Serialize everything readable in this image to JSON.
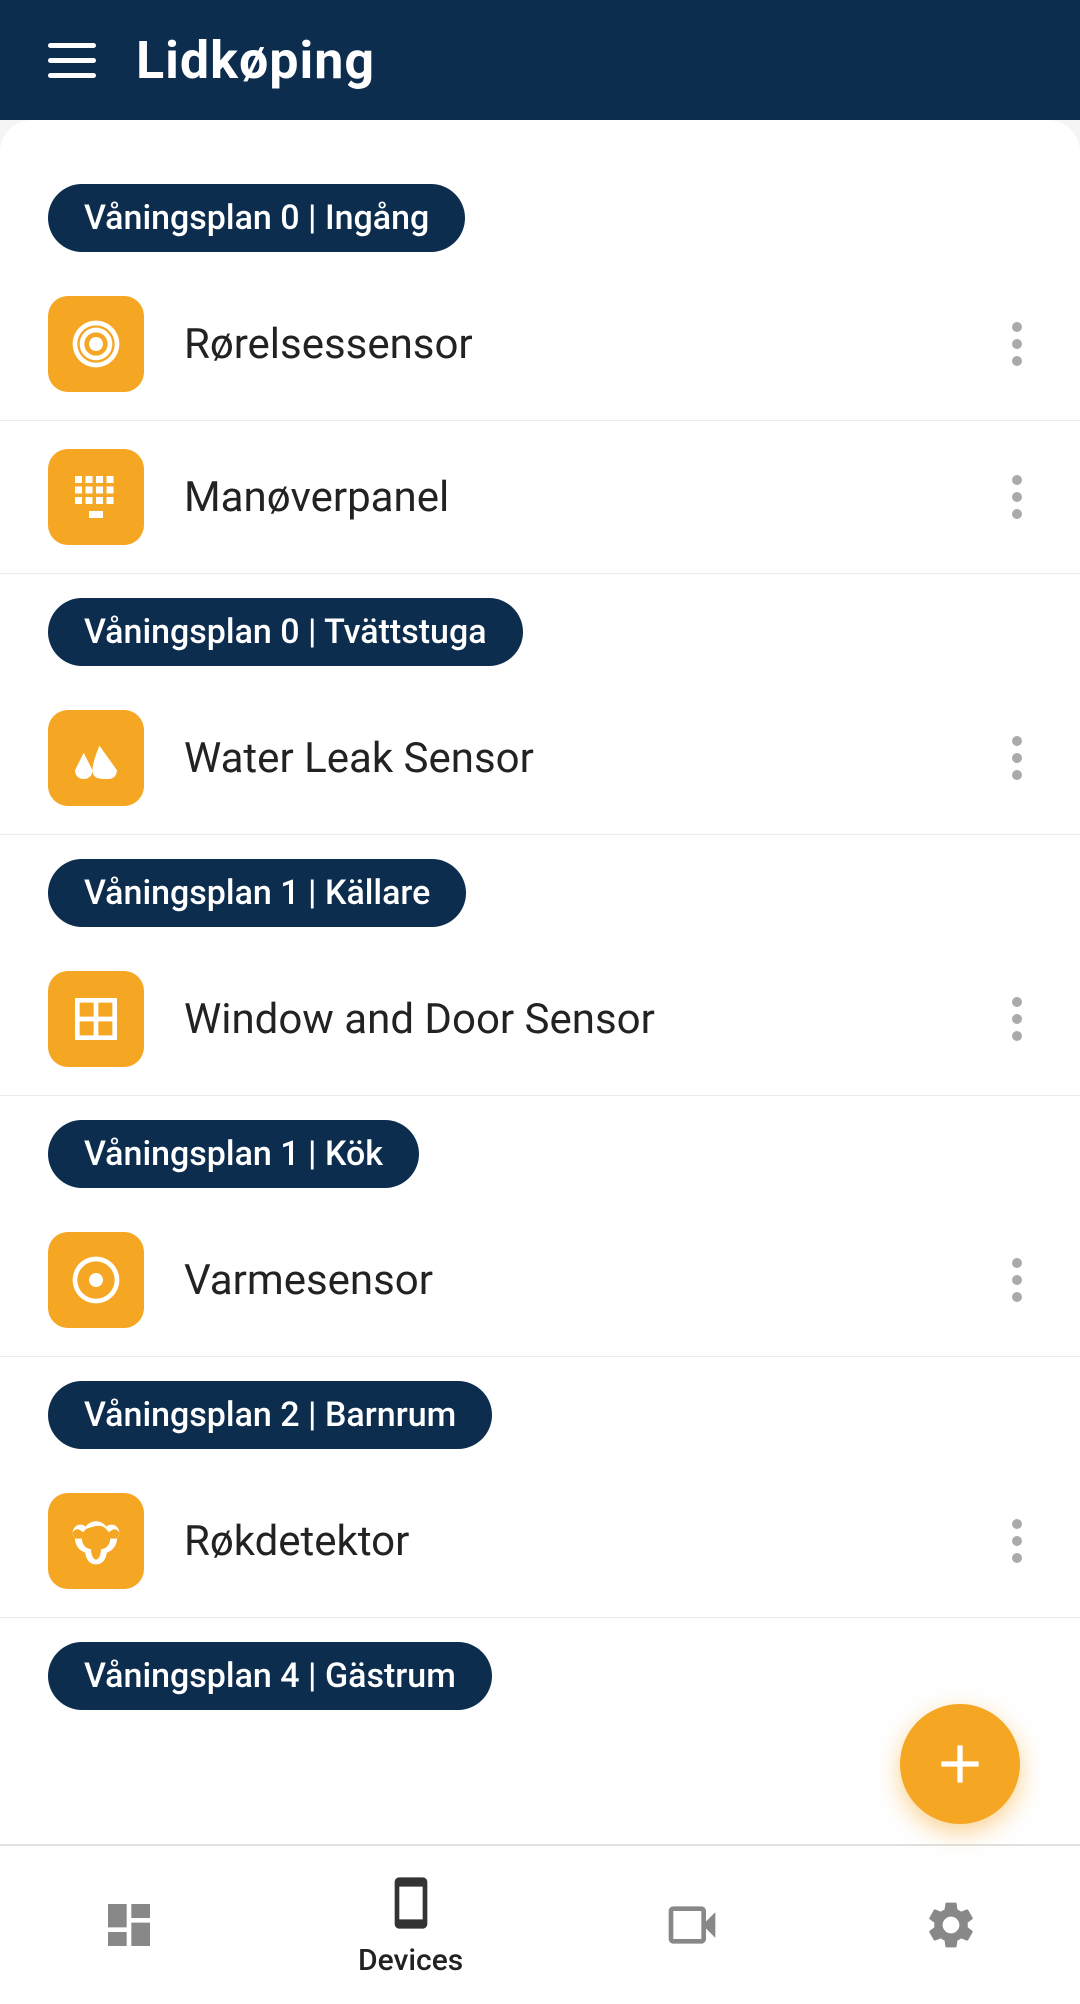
{
  "header": {
    "title": "Lidkøping"
  },
  "zones": [
    {
      "id": "zone1",
      "label": "Våningsplan 0 | Ingång",
      "devices": [
        {
          "id": "d1",
          "name": "Rørelsessensor",
          "icon": "motion"
        },
        {
          "id": "d2",
          "name": "Manøverpanel",
          "icon": "keypad"
        }
      ]
    },
    {
      "id": "zone2",
      "label": "Våningsplan 0 | Tvättstuga",
      "devices": [
        {
          "id": "d3",
          "name": "Water Leak Sensor",
          "icon": "water"
        }
      ]
    },
    {
      "id": "zone3",
      "label": "Våningsplan 1 | Källare",
      "devices": [
        {
          "id": "d4",
          "name": "Window and Door Sensor",
          "icon": "window"
        }
      ]
    },
    {
      "id": "zone4",
      "label": "Våningsplan 1 | Kök",
      "devices": [
        {
          "id": "d5",
          "name": "Varmesensor",
          "icon": "heat"
        }
      ]
    },
    {
      "id": "zone5",
      "label": "Våningsplan 2 | Barnrum",
      "devices": [
        {
          "id": "d6",
          "name": "Røkdetektor",
          "icon": "smoke"
        }
      ]
    },
    {
      "id": "zone6",
      "label": "Våningsplan 4 | Gästrum",
      "devices": []
    }
  ],
  "fab": {
    "label": "Add device"
  },
  "nav": {
    "items": [
      {
        "id": "nav-dashboard",
        "label": "Dashboard",
        "icon": "dashboard"
      },
      {
        "id": "nav-devices",
        "label": "Devices",
        "icon": "devices",
        "active": true
      },
      {
        "id": "nav-cameras",
        "label": "Cameras",
        "icon": "cameras"
      },
      {
        "id": "nav-settings",
        "label": "Settings",
        "icon": "settings"
      }
    ]
  }
}
